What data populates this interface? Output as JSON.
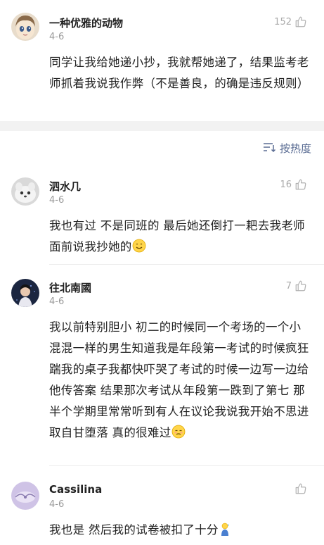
{
  "top_comment": {
    "username": "一种优雅的动物",
    "date": "4-6",
    "likes": "152",
    "text": "同学让我给她递小抄，我就帮她递了，结果监考老师抓着我说我作弊（不是善良，的确是违反规则）"
  },
  "sort": {
    "label": "按热度"
  },
  "comments": [
    {
      "username": "泗水几",
      "date": "4-6",
      "likes": "16",
      "text": "我也有过 不是同班的 最后她还倒打一耙去我老师面前说我抄她的",
      "emoji": "smile-emoji"
    },
    {
      "username": "往北南國",
      "date": "4-6",
      "likes": "7",
      "text": "我以前特别胆小 初二的时候同一个考场的一个小混混一样的男生知道我是年段第一考试的时候疯狂踹我的桌子我都快吓哭了考试的时候一边写一边给他传答案 结果那次考试从年段第一跌到了第七 那半个学期里常常听到有人在议论我说我开始不思进取自甘堕落 真的很难过",
      "emoji": "sad-emoji"
    },
    {
      "username": "Cassilina",
      "date": "4-6",
      "likes": "",
      "text": "我也是 然后我的试卷被扣了十分",
      "emoji": "sweat-emoji"
    }
  ],
  "colors": {
    "accent": "#5a6c93",
    "muted": "#999999",
    "divider": "#f2f2f2"
  }
}
